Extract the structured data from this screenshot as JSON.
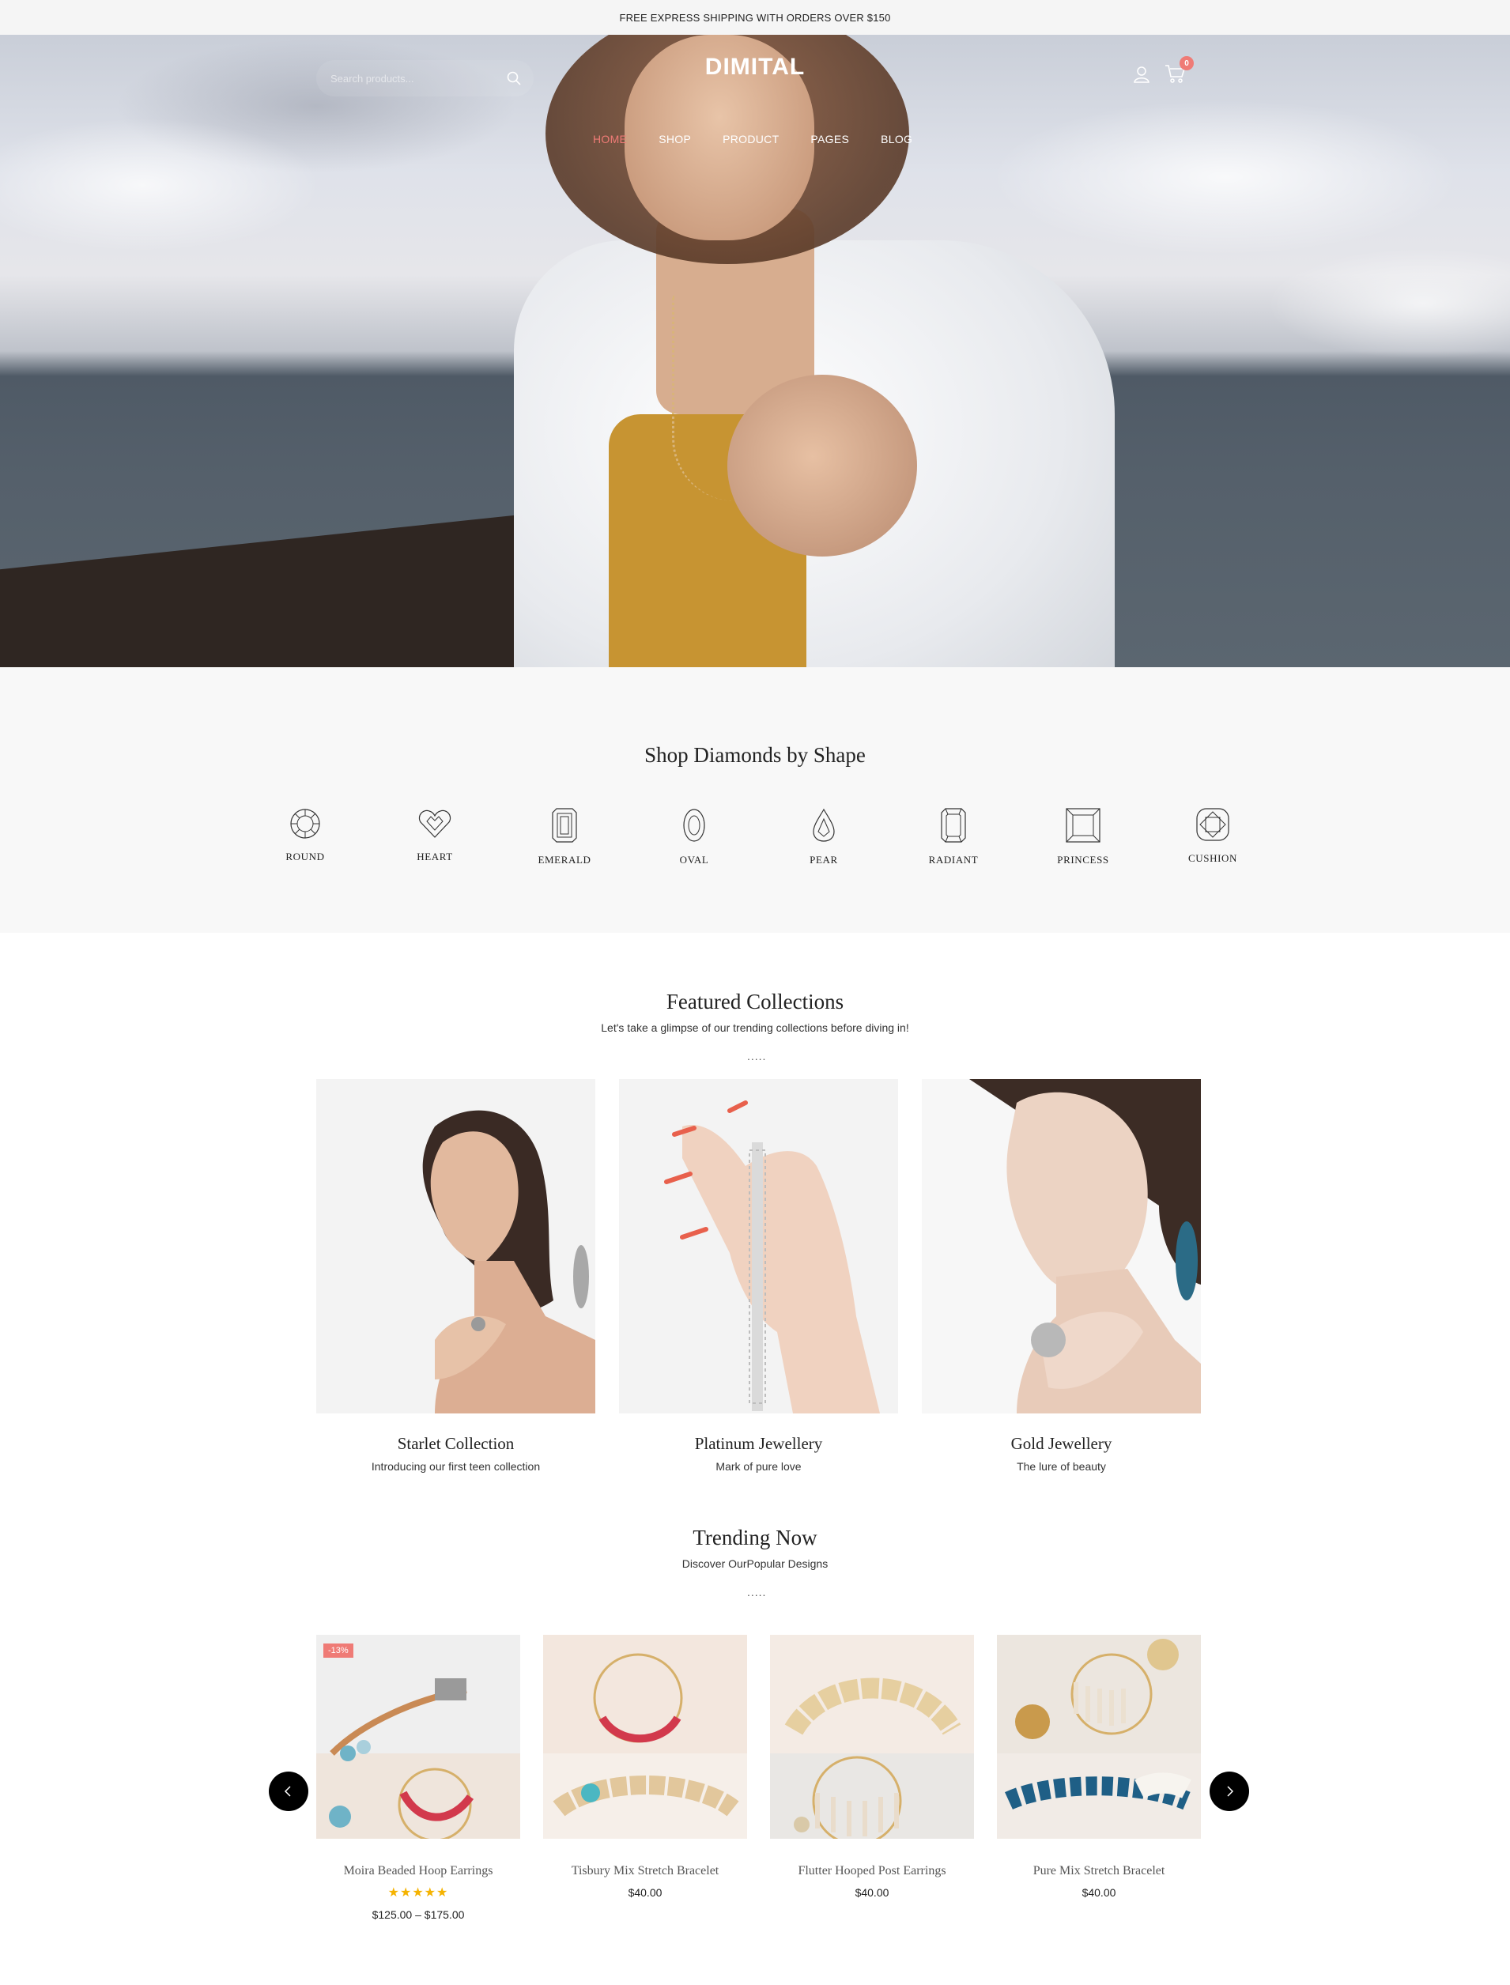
{
  "announcement": "FREE EXPRESS SHIPPING WITH ORDERS OVER $150",
  "header": {
    "search_placeholder": "Search products...",
    "logo": "DIMITAL",
    "cart_count": "0",
    "nav": [
      "HOME",
      "SHOP",
      "PRODUCT",
      "PAGES",
      "BLOG"
    ],
    "active_nav": "HOME"
  },
  "shapes": {
    "title": "Shop Diamonds by Shape",
    "items": [
      "ROUND",
      "HEART",
      "EMERALD",
      "OVAL",
      "PEAR",
      "RADIANT",
      "PRINCESS",
      "CUSHION"
    ]
  },
  "featured": {
    "title": "Featured Collections",
    "subtitle": "Let's take a glimpse of our trending collections before diving in!",
    "divider": ".....",
    "collections": [
      {
        "name": "Starlet Collection",
        "desc": "Introducing our first teen collection"
      },
      {
        "name": "Platinum Jewellery",
        "desc": "Mark of pure love"
      },
      {
        "name": "Gold Jewellery",
        "desc": "The lure of beauty"
      }
    ]
  },
  "trending": {
    "title": "Trending Now",
    "subtitle": "Discover OurPopular Designs",
    "divider": ".....",
    "products": [
      {
        "name": "Moira Beaded Hoop Earrings",
        "price": "$125.00 – $175.00",
        "badge": "-13%",
        "rating": 5,
        "stars": "★★★★★"
      },
      {
        "name": "Tisbury Mix Stretch Bracelet",
        "price": "$40.00"
      },
      {
        "name": "Flutter Hooped Post Earrings",
        "price": "$40.00"
      },
      {
        "name": "Pure Mix Stretch Bracelet",
        "price": "$40.00"
      }
    ]
  },
  "colors": {
    "accent": "#ef7b76",
    "star": "#f5b301",
    "topbar_bg": "#f5f5f5",
    "section_bg": "#f8f8f8"
  },
  "icons": [
    "search-icon",
    "user-icon",
    "cart-icon",
    "chevron-left-icon",
    "chevron-right-icon"
  ]
}
